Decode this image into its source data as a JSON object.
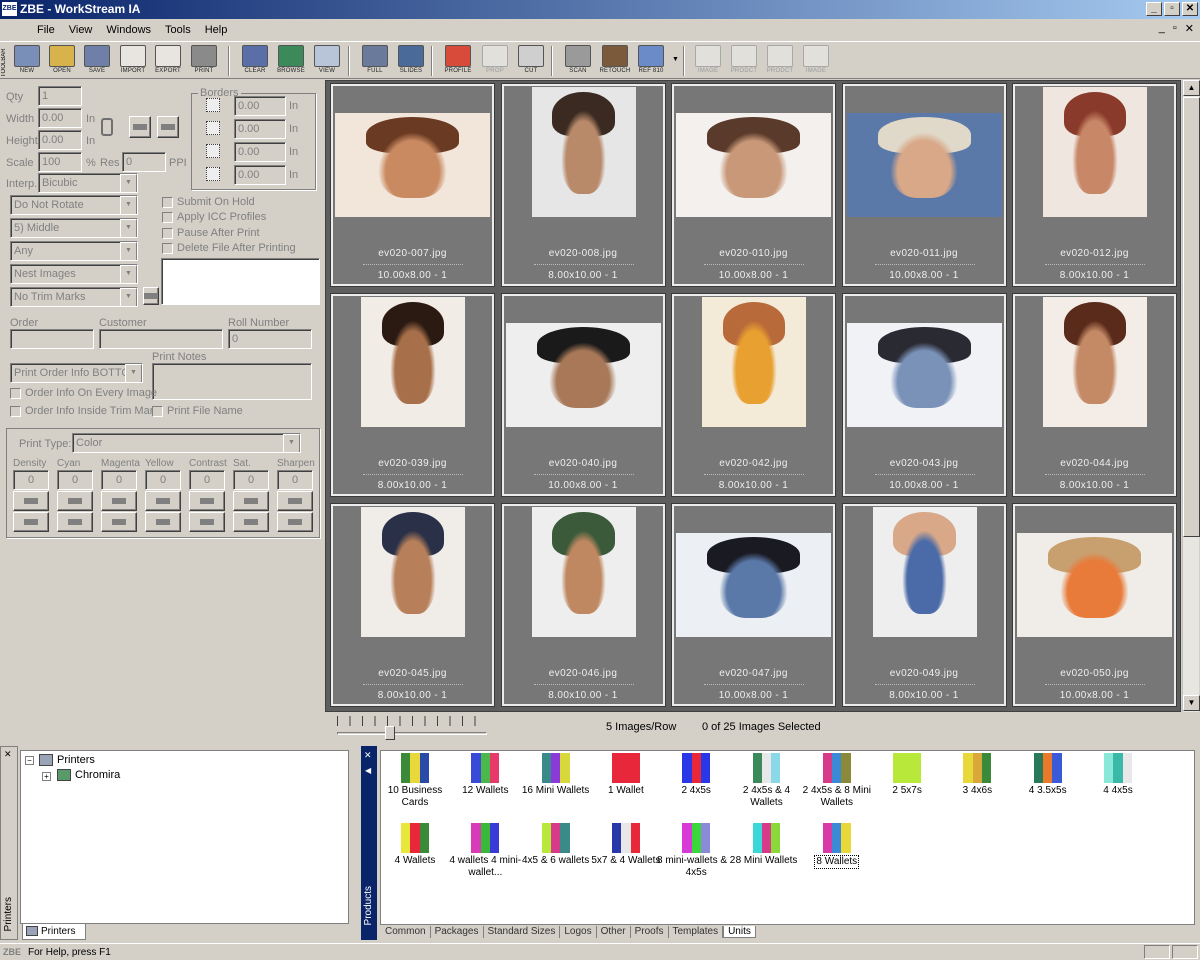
{
  "title_bar": {
    "logo": "ZBE",
    "title": "ZBE - WorkStream IA",
    "controls": [
      "_",
      "▫",
      "✕"
    ]
  },
  "menu": [
    "File",
    "View",
    "Windows",
    "Tools",
    "Help"
  ],
  "mdi_controls": [
    "_",
    "▫",
    "✕"
  ],
  "toolbar": {
    "side_label": "TOOLBAR",
    "buttons": [
      {
        "label": "NEW",
        "icon": "new-icon",
        "color": "#7a8fb8",
        "enabled": true
      },
      {
        "label": "OPEN",
        "icon": "open-folder-icon",
        "color": "#d8b24a",
        "enabled": true
      },
      {
        "label": "SAVE",
        "icon": "save-disk-icon",
        "color": "#6f7fa8",
        "enabled": true
      },
      {
        "label": "IMPORT",
        "icon": "import-icon",
        "color": "#e8e4e0",
        "enabled": true
      },
      {
        "label": "EXPORT",
        "icon": "export-icon",
        "color": "#e8e4e0",
        "enabled": true
      },
      {
        "label": "PRINT",
        "icon": "printer-icon",
        "color": "#8a8a8a",
        "enabled": true
      },
      {
        "label": "CLEAR",
        "icon": "clear-icon",
        "color": "#5a6ea8",
        "enabled": true
      },
      {
        "label": "BROWSE",
        "icon": "browse-icon",
        "color": "#3c8a5a",
        "enabled": true
      },
      {
        "label": "VIEW",
        "icon": "view-icon",
        "color": "#b8c4d8",
        "enabled": true
      },
      {
        "label": "FULL",
        "icon": "full-screen-icon",
        "color": "#6a7a9a",
        "enabled": true
      },
      {
        "label": "SLIDES",
        "icon": "slides-icon",
        "color": "#4a6a9a",
        "enabled": true
      },
      {
        "label": "PROFILE",
        "icon": "profile-rainbow-icon",
        "color": "#d84a3a",
        "enabled": true
      },
      {
        "label": "PROP",
        "icon": "properties-icon",
        "color": "#cfcfcf",
        "enabled": false
      },
      {
        "label": "CUT",
        "icon": "cut-icon",
        "color": "#cfcfcf",
        "enabled": true
      },
      {
        "label": "SCAN",
        "icon": "scanner-icon",
        "color": "#9a9a9a",
        "enabled": true
      },
      {
        "label": "RETOUCH",
        "icon": "retouch-brush-icon",
        "color": "#7a5a3a",
        "enabled": true
      },
      {
        "label": "REF 810",
        "icon": "ref-icon",
        "color": "#6a8ac8",
        "enabled": true
      },
      {
        "label": "IMAGE",
        "icon": "first-image-icon",
        "color": "#cfcfcf",
        "enabled": false
      },
      {
        "label": "PRODCT",
        "icon": "prev-product-icon",
        "color": "#cfcfcf",
        "enabled": false
      },
      {
        "label": "PRODCT",
        "icon": "next-product-icon",
        "color": "#cfcfcf",
        "enabled": false
      },
      {
        "label": "IMAGE",
        "icon": "last-image-icon",
        "color": "#cfcfcf",
        "enabled": false
      }
    ]
  },
  "form": {
    "qty_label": "Qty",
    "qty": "1",
    "width_label": "Width",
    "width": "0.00",
    "width_unit": "In",
    "height_label": "Height",
    "height": "0.00",
    "height_unit": "In",
    "scale_label": "Scale",
    "scale": "100",
    "scale_unit": "%",
    "res_label": "Res",
    "res": "0",
    "res_unit": "PPI",
    "interp_label": "Interp.",
    "interp": "Bicubic",
    "borders_label": "Borders",
    "borders": [
      "0.00",
      "0.00",
      "0.00",
      "0.00"
    ],
    "border_unit": "In",
    "rotate": "Do Not Rotate",
    "position": "5) Middle",
    "printer_any": "Any",
    "nest": "Nest Images",
    "trim": "No Trim Marks",
    "trim_btn": "...",
    "checks": [
      "Submit On Hold",
      "Apply ICC Profiles",
      "Pause After Print",
      "Delete File After Printing"
    ],
    "order_label": "Order",
    "customer_label": "Customer",
    "roll_label": "Roll Number",
    "roll": "0",
    "print_order": "Print Order Info BOTTOM",
    "print_notes_label": "Print Notes",
    "order_every": "Order Info On Every Image",
    "order_inside": "Order Info Inside Trim Mark",
    "print_filename": "Print File Name",
    "print_type_label": "Print Type:",
    "print_type": "Color",
    "adjust": [
      {
        "label": "Density",
        "value": "0"
      },
      {
        "label": "Cyan",
        "value": "0"
      },
      {
        "label": "Magenta",
        "value": "0"
      },
      {
        "label": "Yellow",
        "value": "0"
      },
      {
        "label": "Contrast",
        "value": "0"
      },
      {
        "label": "Sat.",
        "value": "0"
      },
      {
        "label": "Sharpen",
        "value": "0"
      }
    ]
  },
  "images": [
    {
      "file": "ev020-007.jpg",
      "size": "10.00x8.00 - 1",
      "orient": "land",
      "tone": [
        "#f2e6da",
        "#c98a62",
        "#6b3a22"
      ]
    },
    {
      "file": "ev020-008.jpg",
      "size": "8.00x10.00 - 1",
      "orient": "port",
      "tone": [
        "#e6e6e6",
        "#b88a6a",
        "#3a2a22"
      ]
    },
    {
      "file": "ev020-010.jpg",
      "size": "10.00x8.00 - 1",
      "orient": "land",
      "tone": [
        "#f4f0ee",
        "#c89878",
        "#5a3a2a"
      ]
    },
    {
      "file": "ev020-011.jpg",
      "size": "10.00x8.00 - 1",
      "orient": "land",
      "tone": [
        "#5a78a8",
        "#d8a888",
        "#e0d8c8"
      ]
    },
    {
      "file": "ev020-012.jpg",
      "size": "8.00x10.00 - 1",
      "orient": "port",
      "tone": [
        "#f0e6e0",
        "#c88868",
        "#8a3a2a"
      ]
    },
    {
      "file": "ev020-039.jpg",
      "size": "8.00x10.00 - 1",
      "orient": "port",
      "tone": [
        "#f2ece6",
        "#a8704a",
        "#2a1a12"
      ]
    },
    {
      "file": "ev020-040.jpg",
      "size": "10.00x8.00 - 1",
      "orient": "land",
      "tone": [
        "#eeeeee",
        "#a87858",
        "#1a1a1a"
      ]
    },
    {
      "file": "ev020-042.jpg",
      "size": "8.00x10.00 - 1",
      "orient": "port",
      "tone": [
        "#f4ead8",
        "#e8a030",
        "#b86a3a"
      ]
    },
    {
      "file": "ev020-043.jpg",
      "size": "10.00x8.00 - 1",
      "orient": "land",
      "tone": [
        "#f0f2f6",
        "#7a92b8",
        "#2a2a32"
      ]
    },
    {
      "file": "ev020-044.jpg",
      "size": "8.00x10.00 - 1",
      "orient": "port",
      "tone": [
        "#f4ece6",
        "#c48a66",
        "#5a2a1a"
      ]
    },
    {
      "file": "ev020-045.jpg",
      "size": "8.00x10.00 - 1",
      "orient": "port",
      "tone": [
        "#f0ece8",
        "#b8805a",
        "#2a3048"
      ]
    },
    {
      "file": "ev020-046.jpg",
      "size": "8.00x10.00 - 1",
      "orient": "port",
      "tone": [
        "#eeeeee",
        "#c08860",
        "#3a5a3a"
      ]
    },
    {
      "file": "ev020-047.jpg",
      "size": "10.00x8.00 - 1",
      "orient": "land",
      "tone": [
        "#ecf0f4",
        "#5a78a8",
        "#1a1a22"
      ]
    },
    {
      "file": "ev020-049.jpg",
      "size": "8.00x10.00 - 1",
      "orient": "port",
      "tone": [
        "#eeeeee",
        "#4a6aa8",
        "#d8a888"
      ]
    },
    {
      "file": "ev020-050.jpg",
      "size": "10.00x8.00 - 1",
      "orient": "land",
      "tone": [
        "#f0ede8",
        "#e87a3a",
        "#c8a070"
      ]
    }
  ],
  "status": {
    "images_per_row": "5 Images/Row",
    "selected": "0 of 25 Images Selected",
    "slider_value": 0.35
  },
  "tree": {
    "root": "Printers",
    "child": "Chromira",
    "tab": "Printers",
    "side_label": "Printers"
  },
  "products": {
    "side_label": "Products",
    "items": [
      {
        "label": "10 Business Cards",
        "colors": [
          "#3a8a3a",
          "#e8d83a",
          "#2a4aa8"
        ]
      },
      {
        "label": "12 Wallets",
        "colors": [
          "#3a4ad8",
          "#4ab84a",
          "#e83a6a"
        ]
      },
      {
        "label": "16 Mini Wallets",
        "colors": [
          "#3a8a8a",
          "#8a3ad8",
          "#d8d83a"
        ]
      },
      {
        "label": "1 Wallet",
        "colors": [
          "#e8283a",
          "#e8283a",
          "#e8283a"
        ]
      },
      {
        "label": "2 4x5s",
        "colors": [
          "#2838e8",
          "#e82838",
          "#2838e8"
        ]
      },
      {
        "label": "2 4x5s & 4 Wallets",
        "colors": [
          "#3a8a5a",
          "#e8e8e8",
          "#8ad8e8"
        ]
      },
      {
        "label": "2 4x5s & 8 Mini Wallets",
        "colors": [
          "#d83a8a",
          "#3a8ad8",
          "#8a8a3a"
        ]
      },
      {
        "label": "2 5x7s",
        "colors": [
          "#b8e83a",
          "#b8e83a",
          "#b8e83a"
        ]
      },
      {
        "label": "3 4x6s",
        "colors": [
          "#e8d83a",
          "#d8a83a",
          "#3a8a3a"
        ]
      },
      {
        "label": "4 3.5x5s",
        "colors": [
          "#2a7a5a",
          "#e87a2a",
          "#3a5ad8"
        ]
      },
      {
        "label": "4 4x5s",
        "colors": [
          "#8ae8d8",
          "#3ab8a8",
          "#e8e8e8"
        ]
      },
      {
        "label": "4 Wallets",
        "colors": [
          "#e8e83a",
          "#e8283a",
          "#3a8a3a"
        ]
      },
      {
        "label": "4 wallets 4 mini-wallet...",
        "colors": [
          "#d83ab8",
          "#3ab83a",
          "#3a3ad8"
        ]
      },
      {
        "label": "4x5 & 6 wallets",
        "colors": [
          "#b8e83a",
          "#d83a8a",
          "#3a8a8a"
        ]
      },
      {
        "label": "5x7 & 4 Wallets",
        "colors": [
          "#2838a8",
          "#e8e8e8",
          "#e82838"
        ]
      },
      {
        "label": "8 mini-wallets & 2 4x5s",
        "colors": [
          "#d83ad8",
          "#3ad83a",
          "#8a8ad8"
        ]
      },
      {
        "label": "8 Mini Wallets",
        "colors": [
          "#3ad8d8",
          "#d83a8a",
          "#8ad83a"
        ]
      },
      {
        "label": "8 Wallets",
        "colors": [
          "#d83aa8",
          "#3a8ad8",
          "#e8d83a"
        ]
      }
    ]
  },
  "product_tabs": [
    "Common",
    "Packages",
    "Standard Sizes",
    "Logos",
    "Other",
    "Proofs",
    "Templates",
    "Units"
  ],
  "active_product_tab": "Units",
  "statusbar": {
    "logo": "ZBE",
    "help": "For Help, press F1"
  }
}
